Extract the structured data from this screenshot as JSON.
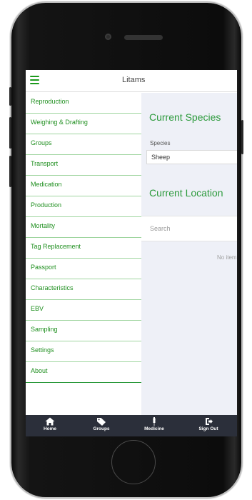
{
  "app": {
    "title": "Litams"
  },
  "sidebar": {
    "items": [
      {
        "label": "Reproduction"
      },
      {
        "label": "Weighing & Drafting"
      },
      {
        "label": "Groups"
      },
      {
        "label": "Transport"
      },
      {
        "label": "Medication"
      },
      {
        "label": "Production"
      },
      {
        "label": "Mortality"
      },
      {
        "label": "Tag Replacement"
      },
      {
        "label": "Passport"
      },
      {
        "label": "Characteristics"
      },
      {
        "label": "EBV"
      },
      {
        "label": "Sampling"
      },
      {
        "label": "Settings"
      },
      {
        "label": "About"
      }
    ]
  },
  "main": {
    "current_species_title": "Current Species",
    "species_label": "Species",
    "species_value": "Sheep",
    "current_location_title": "Current Location",
    "search_placeholder": "Search",
    "no_items_text": "No items"
  },
  "bottom_nav": {
    "items": [
      {
        "label": "Home",
        "icon": "home-icon"
      },
      {
        "label": "Groups",
        "icon": "tag-icon"
      },
      {
        "label": "Medicine",
        "icon": "syringe-icon"
      },
      {
        "label": "Sign Out",
        "icon": "sign-out-icon"
      }
    ]
  },
  "colors": {
    "accent": "#1f8f1f",
    "bottom_bar": "#2b2f3a",
    "content_bg": "#eef0f7"
  }
}
